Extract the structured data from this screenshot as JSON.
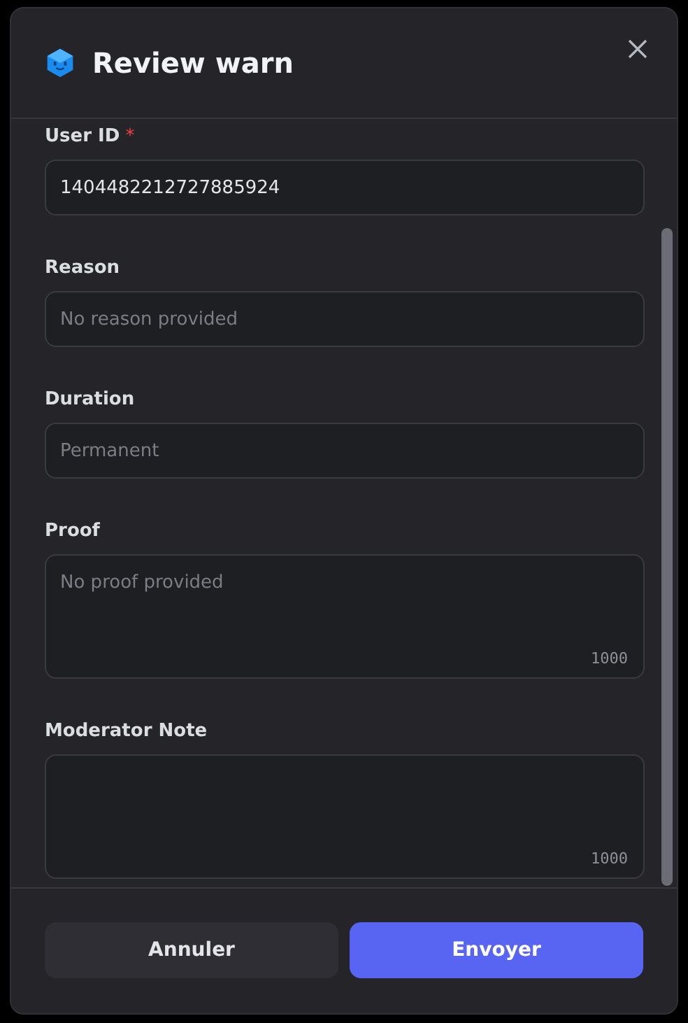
{
  "dialog": {
    "title": "Review warn"
  },
  "fields": [
    {
      "kind": "input",
      "label": "User ID",
      "required_mark": "*",
      "value": "1404482212727885924"
    },
    {
      "kind": "input",
      "label": "Reason",
      "placeholder": "No reason provided"
    },
    {
      "kind": "input",
      "label": "Duration",
      "placeholder": "Permanent"
    },
    {
      "kind": "textarea",
      "label": "Proof",
      "placeholder": "No proof provided",
      "counter": "1000"
    },
    {
      "kind": "textarea",
      "label": "Moderator Note",
      "counter": "1000"
    }
  ],
  "buttons": [
    {
      "kind": "secondary",
      "label": "Annuler"
    },
    {
      "kind": "primary",
      "label": "Envoyer"
    }
  ]
}
